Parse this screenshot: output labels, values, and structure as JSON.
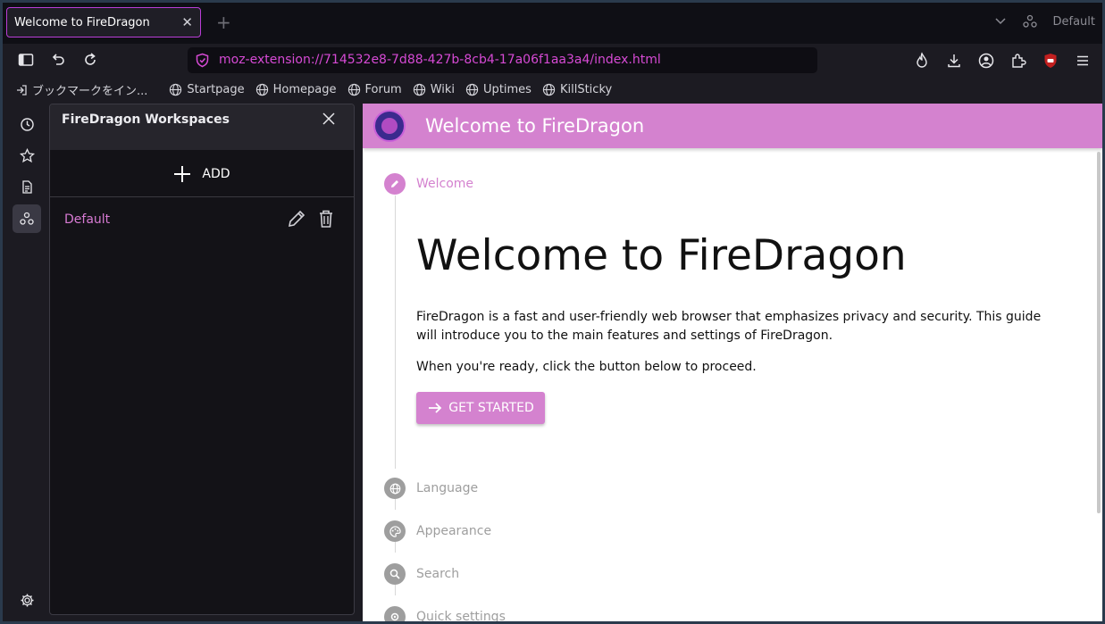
{
  "tab": {
    "title": "Welcome to FireDragon",
    "close": "✕"
  },
  "newtab": "+",
  "toolbar_right": {
    "profile_label": "Default"
  },
  "urlbar": {
    "url": "moz-extension://714532e8-7d88-427b-8cb4-17a06f1aa3a4/index.html"
  },
  "bookmarks": [
    {
      "label": "ブックマークをイン..."
    },
    {
      "label": "Startpage"
    },
    {
      "label": "Homepage"
    },
    {
      "label": "Forum"
    },
    {
      "label": "Wiki"
    },
    {
      "label": "Uptimes"
    },
    {
      "label": "KillSticky"
    }
  ],
  "workspaces": {
    "title": "FireDragon Workspaces",
    "add_label": "ADD",
    "items": [
      {
        "label": "Default"
      }
    ]
  },
  "content": {
    "header_title": "Welcome to FireDragon",
    "steps": [
      {
        "label": "Welcome"
      },
      {
        "label": "Language"
      },
      {
        "label": "Appearance"
      },
      {
        "label": "Search"
      },
      {
        "label": "Quick settings"
      }
    ],
    "heading": "Welcome to FireDragon",
    "paragraph": "FireDragon is a fast and user-friendly web browser that emphasizes privacy and security. This guide will introduce you to the main features and settings of FireDragon.",
    "paragraph2": "When you're ready, click the button below to proceed.",
    "get_started_label": "GET STARTED"
  },
  "colors": {
    "accent": "#d482cf",
    "tab_border": "#b93dd6",
    "url_text": "#d64ad4"
  }
}
